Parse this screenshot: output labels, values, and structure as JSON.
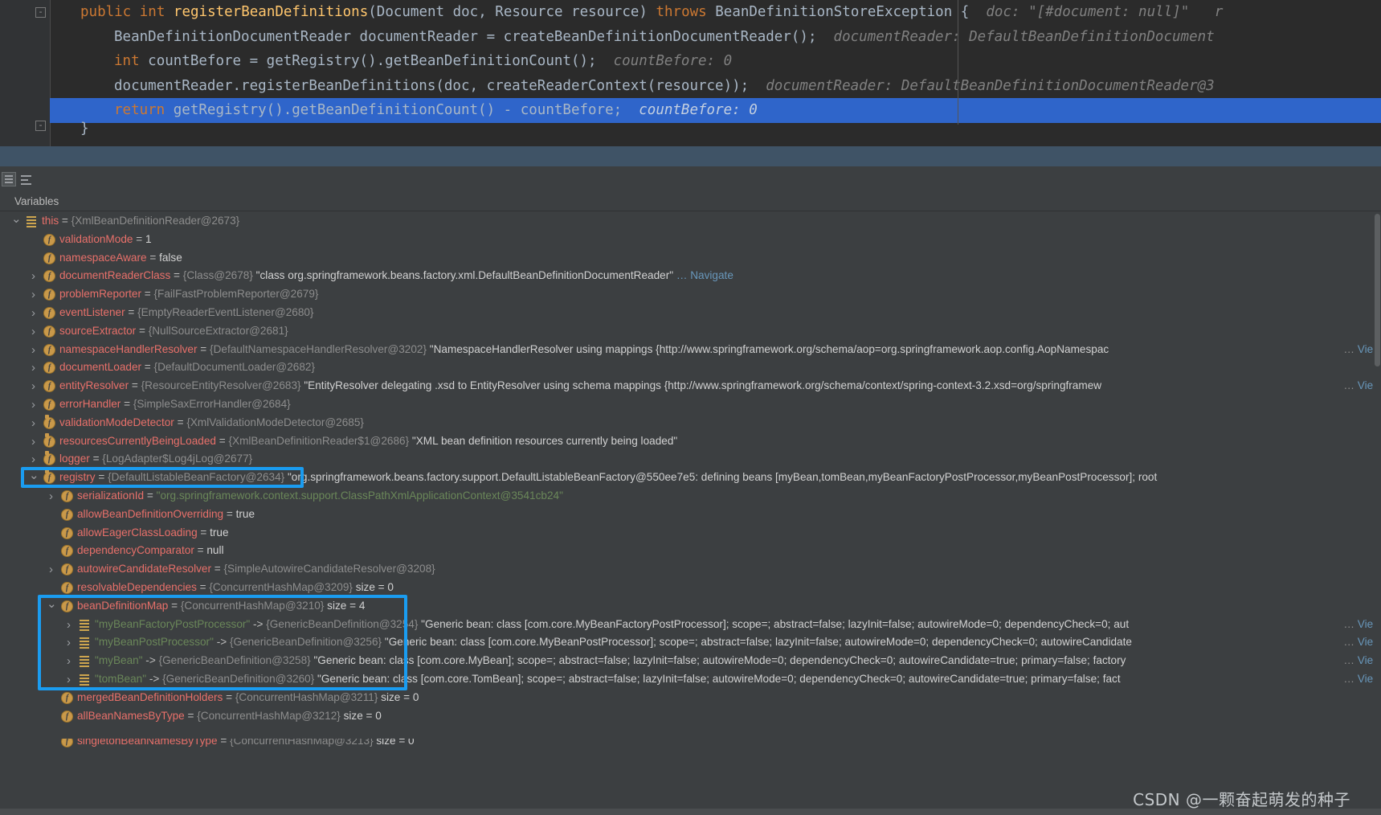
{
  "editor": {
    "lines": [
      {
        "id": "line-signature",
        "segments": [
          {
            "cls": "kw",
            "text": "public "
          },
          {
            "cls": "kw",
            "text": "int "
          },
          {
            "cls": "mth",
            "text": "registerBeanDefinitions"
          },
          {
            "cls": "",
            "text": "(Document doc, Resource resource) "
          },
          {
            "cls": "kw",
            "text": "throws "
          },
          {
            "cls": "",
            "text": "BeanDefinitionStoreException {"
          }
        ],
        "hint": "doc: \"[#document: null]\"   r",
        "indent": 0,
        "selected": false
      },
      {
        "id": "line-document-reader",
        "segments": [
          {
            "cls": "",
            "text": "BeanDefinitionDocumentReader documentReader = createBeanDefinitionDocumentReader();"
          }
        ],
        "hint": "documentReader: DefaultBeanDefinitionDocument",
        "indent": 1,
        "selected": false
      },
      {
        "id": "line-count-before",
        "segments": [
          {
            "cls": "kw",
            "text": "int "
          },
          {
            "cls": "",
            "text": "countBefore = getRegistry().getBeanDefinitionCount();"
          }
        ],
        "hint": "countBefore: 0",
        "indent": 1,
        "selected": false
      },
      {
        "id": "line-register-call",
        "segments": [
          {
            "cls": "",
            "text": "documentReader.registerBeanDefinitions(doc, createReaderContext(resource));"
          }
        ],
        "hint": "documentReader: DefaultBeanDefinitionDocumentReader@3",
        "indent": 1,
        "selected": false
      },
      {
        "id": "line-return",
        "segments": [
          {
            "cls": "kw",
            "text": "return "
          },
          {
            "cls": "",
            "text": "getRegistry().getBeanDefinitionCount() - countBefore;"
          }
        ],
        "hint": "countBefore: 0",
        "indent": 1,
        "selected": true
      }
    ],
    "closing_brace": "}",
    "fold_marker": "-"
  },
  "toolbar": {
    "icons": [
      {
        "name": "watches-panel-icon",
        "selected": true
      },
      {
        "name": "sort-variables-icon",
        "selected": false
      }
    ]
  },
  "variables_header": {
    "title": "Variables"
  },
  "highlights": {
    "accent_color": "#1a9cf0",
    "boxes": [
      {
        "name": "registry-highlight",
        "target": "registry row"
      },
      {
        "name": "bean-definition-map-highlight",
        "target": "beanDefinitionMap subtree"
      }
    ]
  },
  "watermark": {
    "text": "CSDN @一颗奋起萌发的种子"
  },
  "links": {
    "navigate": "… Navigate",
    "view": "View",
    "ellipsis": "…"
  },
  "tree": {
    "rows": [
      {
        "id": "row-this",
        "depth": 0,
        "chev": "down",
        "icon": "list",
        "name": "this",
        "name_cls": "nm",
        "eq": " = ",
        "type": "{XmlBeanDefinitionReader@2673}",
        "value": "",
        "size": "",
        "link": ""
      },
      {
        "id": "row-validationMode",
        "depth": 1,
        "chev": "none",
        "icon": "field",
        "name": "validationMode",
        "name_cls": "nm",
        "eq": " = ",
        "type": "",
        "value": "1",
        "size": "",
        "link": ""
      },
      {
        "id": "row-namespaceAware",
        "depth": 1,
        "chev": "none",
        "icon": "field",
        "name": "namespaceAware",
        "name_cls": "nm",
        "eq": " = ",
        "type": "",
        "value": "false",
        "size": "",
        "link": ""
      },
      {
        "id": "row-documentReaderClass",
        "depth": 1,
        "chev": "right",
        "icon": "field",
        "name": "documentReaderClass",
        "name_cls": "nm",
        "eq": " = ",
        "type": "{Class@2678}",
        "value": "\"class org.springframework.beans.factory.xml.DefaultBeanDefinitionDocumentReader\"",
        "size": "",
        "link": "navigate"
      },
      {
        "id": "row-problemReporter",
        "depth": 1,
        "chev": "right",
        "icon": "field",
        "name": "problemReporter",
        "name_cls": "nm",
        "eq": " = ",
        "type": "{FailFastProblemReporter@2679}",
        "value": "",
        "size": "",
        "link": ""
      },
      {
        "id": "row-eventListener",
        "depth": 1,
        "chev": "right",
        "icon": "field",
        "name": "eventListener",
        "name_cls": "nm",
        "eq": " = ",
        "type": "{EmptyReaderEventListener@2680}",
        "value": "",
        "size": "",
        "link": ""
      },
      {
        "id": "row-sourceExtractor",
        "depth": 1,
        "chev": "right",
        "icon": "field",
        "name": "sourceExtractor",
        "name_cls": "nm",
        "eq": " = ",
        "type": "{NullSourceExtractor@2681}",
        "value": "",
        "size": "",
        "link": ""
      },
      {
        "id": "row-namespaceHandlerResolver",
        "depth": 1,
        "chev": "right",
        "icon": "field",
        "name": "namespaceHandlerResolver",
        "name_cls": "nm",
        "eq": " = ",
        "type": "{DefaultNamespaceHandlerResolver@3202}",
        "value": "\"NamespaceHandlerResolver using mappings {http://www.springframework.org/schema/aop=org.springframework.aop.config.AopNamespac",
        "size": "",
        "link": "view"
      },
      {
        "id": "row-documentLoader",
        "depth": 1,
        "chev": "right",
        "icon": "field",
        "name": "documentLoader",
        "name_cls": "nm",
        "eq": " = ",
        "type": "{DefaultDocumentLoader@2682}",
        "value": "",
        "size": "",
        "link": ""
      },
      {
        "id": "row-entityResolver",
        "depth": 1,
        "chev": "right",
        "icon": "field",
        "name": "entityResolver",
        "name_cls": "nm",
        "eq": " = ",
        "type": "{ResourceEntityResolver@2683}",
        "value": "\"EntityResolver delegating .xsd to EntityResolver using schema mappings {http://www.springframework.org/schema/context/spring-context-3.2.xsd=org/springframew",
        "size": "",
        "link": "view"
      },
      {
        "id": "row-errorHandler",
        "depth": 1,
        "chev": "right",
        "icon": "field",
        "name": "errorHandler",
        "name_cls": "nm",
        "eq": " = ",
        "type": "{SimpleSaxErrorHandler@2684}",
        "value": "",
        "size": "",
        "link": ""
      },
      {
        "id": "row-validationModeDetector",
        "depth": 1,
        "chev": "right",
        "icon": "field-static",
        "name": "validationModeDetector",
        "name_cls": "nm",
        "eq": " = ",
        "type": "{XmlValidationModeDetector@2685}",
        "value": "",
        "size": "",
        "link": ""
      },
      {
        "id": "row-resourcesCurrentlyBeingLoaded",
        "depth": 1,
        "chev": "right",
        "icon": "field-static",
        "name": "resourcesCurrentlyBeingLoaded",
        "name_cls": "nm",
        "eq": " = ",
        "type": "{XmlBeanDefinitionReader$1@2686}",
        "value": "\"XML bean definition resources currently being loaded\"",
        "size": "",
        "link": ""
      },
      {
        "id": "row-logger",
        "depth": 1,
        "chev": "right",
        "icon": "field-static",
        "name": "logger",
        "name_cls": "nm",
        "eq": " = ",
        "type": "{LogAdapter$Log4jLog@2677}",
        "value": "",
        "size": "",
        "link": ""
      },
      {
        "id": "row-registry",
        "depth": 1,
        "chev": "down",
        "icon": "field-static",
        "name": "registry",
        "name_cls": "nm",
        "eq": " = ",
        "type": "{DefaultListableBeanFactory@2634}",
        "value": "\"org.springframework.beans.factory.support.DefaultListableBeanFactory@550ee7e5: defining beans [myBean,tomBean,myBeanFactoryPostProcessor,myBeanPostProcessor]; root",
        "size": "",
        "link": ""
      },
      {
        "id": "row-serializationId",
        "depth": 2,
        "chev": "right",
        "icon": "field",
        "name": "serializationId",
        "name_cls": "nm",
        "eq": " = ",
        "type": "",
        "value_green": "\"org.springframework.context.support.ClassPathXmlApplicationContext@3541cb24\"",
        "value": "",
        "size": "",
        "link": ""
      },
      {
        "id": "row-allowBeanDefinitionOverriding",
        "depth": 2,
        "chev": "none",
        "icon": "field",
        "name": "allowBeanDefinitionOverriding",
        "name_cls": "nm",
        "eq": " = ",
        "type": "",
        "value": "true",
        "size": "",
        "link": ""
      },
      {
        "id": "row-allowEagerClassLoading",
        "depth": 2,
        "chev": "none",
        "icon": "field",
        "name": "allowEagerClassLoading",
        "name_cls": "nm",
        "eq": " = ",
        "type": "",
        "value": "true",
        "size": "",
        "link": ""
      },
      {
        "id": "row-dependencyComparator",
        "depth": 2,
        "chev": "none",
        "icon": "field",
        "name": "dependencyComparator",
        "name_cls": "nm",
        "eq": " = ",
        "type": "",
        "value": "null",
        "size": "",
        "link": ""
      },
      {
        "id": "row-autowireCandidateResolver",
        "depth": 2,
        "chev": "right",
        "icon": "field",
        "name": "autowireCandidateResolver",
        "name_cls": "nm",
        "eq": " = ",
        "type": "{SimpleAutowireCandidateResolver@3208}",
        "value": "",
        "size": "",
        "link": ""
      },
      {
        "id": "row-resolvableDependencies",
        "depth": 2,
        "chev": "none",
        "icon": "field",
        "name": "resolvableDependencies",
        "name_cls": "nm",
        "eq": " = ",
        "type": "{ConcurrentHashMap@3209}",
        "value": "",
        "size": "size = 0",
        "link": ""
      },
      {
        "id": "row-beanDefinitionMap",
        "depth": 2,
        "chev": "down",
        "icon": "field",
        "name": "beanDefinitionMap",
        "name_cls": "nm",
        "eq": " = ",
        "type": "{ConcurrentHashMap@3210}",
        "value": "",
        "size": "size = 4",
        "link": ""
      },
      {
        "id": "row-myBeanFactoryPostProcessor",
        "depth": 3,
        "chev": "right",
        "icon": "list",
        "name": "\"myBeanFactoryPostProcessor\"",
        "name_cls": "nm-str",
        "eq": " -> ",
        "type": "{GenericBeanDefinition@3254}",
        "value": "\"Generic bean: class [com.core.MyBeanFactoryPostProcessor]; scope=; abstract=false; lazyInit=false; autowireMode=0; dependencyCheck=0; aut",
        "size": "",
        "link": "view"
      },
      {
        "id": "row-myBeanPostProcessor",
        "depth": 3,
        "chev": "right",
        "icon": "list",
        "name": "\"myBeanPostProcessor\"",
        "name_cls": "nm-str",
        "eq": " -> ",
        "type": "{GenericBeanDefinition@3256}",
        "value": "\"Generic bean: class [com.core.MyBeanPostProcessor]; scope=; abstract=false; lazyInit=false; autowireMode=0; dependencyCheck=0; autowireCandidate",
        "size": "",
        "link": "view"
      },
      {
        "id": "row-myBean",
        "depth": 3,
        "chev": "right",
        "icon": "list",
        "name": "\"myBean\"",
        "name_cls": "nm-str",
        "eq": " -> ",
        "type": "{GenericBeanDefinition@3258}",
        "value": "\"Generic bean: class [com.core.MyBean]; scope=; abstract=false; lazyInit=false; autowireMode=0; dependencyCheck=0; autowireCandidate=true; primary=false; factory",
        "size": "",
        "link": "view"
      },
      {
        "id": "row-tomBean",
        "depth": 3,
        "chev": "right",
        "icon": "list",
        "name": "\"tomBean\"",
        "name_cls": "nm-str",
        "eq": " -> ",
        "type": "{GenericBeanDefinition@3260}",
        "value": "\"Generic bean: class [com.core.TomBean]; scope=; abstract=false; lazyInit=false; autowireMode=0; dependencyCheck=0; autowireCandidate=true; primary=false; fact",
        "size": "",
        "link": "view"
      },
      {
        "id": "row-mergedBeanDefinitionHolders",
        "depth": 2,
        "chev": "none",
        "icon": "field",
        "name": "mergedBeanDefinitionHolders",
        "name_cls": "nm",
        "eq": " = ",
        "type": "{ConcurrentHashMap@3211}",
        "value": "",
        "size": "size = 0",
        "link": ""
      },
      {
        "id": "row-allBeanNamesByType",
        "depth": 2,
        "chev": "none",
        "icon": "field",
        "name": "allBeanNamesByType",
        "name_cls": "nm",
        "eq": " = ",
        "type": "{ConcurrentHashMap@3212}",
        "value": "",
        "size": "size = 0",
        "link": ""
      }
    ],
    "partial_row": {
      "id": "row-singletonBeanNamesByType",
      "depth": 2,
      "chev": "none",
      "icon": "field",
      "name": "singletonBeanNamesByType",
      "name_cls": "nm",
      "eq": " = ",
      "type": "{ConcurrentHashMap@3213}",
      "value": "",
      "size": "size = 0",
      "link": ""
    }
  }
}
